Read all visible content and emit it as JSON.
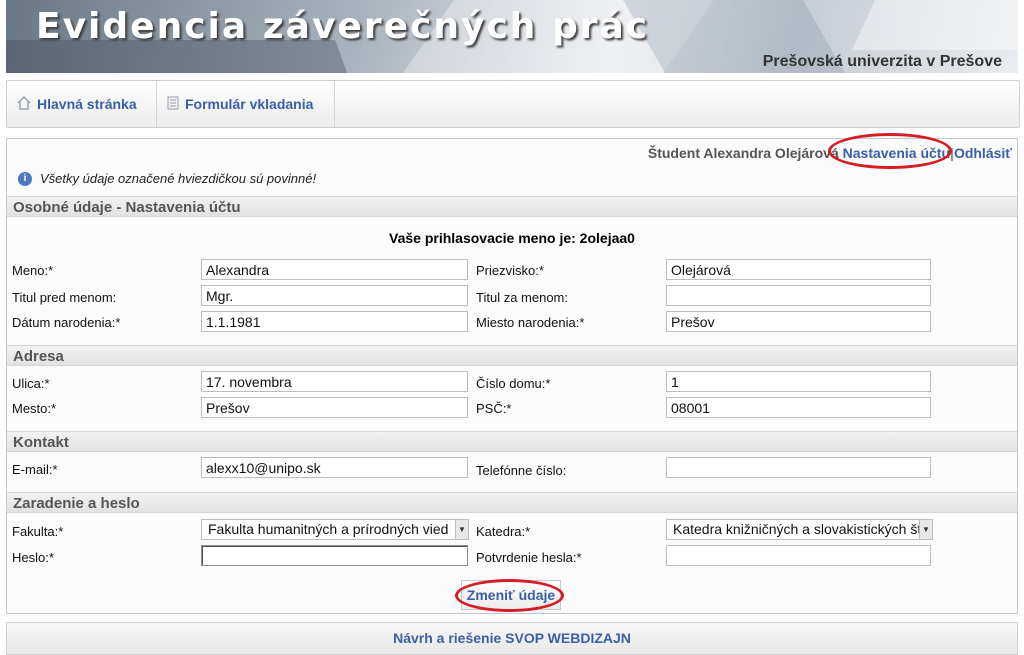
{
  "header": {
    "title": "Evidencia záverečných prác",
    "university": "Prešovská univerzita v Prešove"
  },
  "nav": {
    "items": [
      {
        "label": "Hlavná stránka",
        "icon": "home-icon"
      },
      {
        "label": "Formulár vkladania",
        "icon": "document-icon"
      }
    ]
  },
  "user": {
    "name": "Študent Alexandra Olejárová",
    "settings_link": "Nastavenia účtu",
    "separator": "|",
    "logout_link": "Odhlásiť"
  },
  "info_message": "Všetky údaje označené hviezdičkou sú povinné!",
  "sections": {
    "personal": "Osobné údaje - Nastavenia účtu",
    "address": "Adresa",
    "contact": "Kontakt",
    "assignment": "Zaradenie a heslo"
  },
  "login_line": "Vaše prihlasovacie meno je: 2olejaa0",
  "fields": {
    "meno": {
      "label": "Meno:*",
      "value": "Alexandra"
    },
    "priezvisko": {
      "label": "Priezvisko:*",
      "value": "Olejárová"
    },
    "titul_pred": {
      "label": "Titul pred menom:",
      "value": "Mgr."
    },
    "titul_za": {
      "label": "Titul za menom:",
      "value": ""
    },
    "datum": {
      "label": "Dátum narodenia:*",
      "value": "1.1.1981"
    },
    "miesto": {
      "label": "Miesto narodenia:*",
      "value": "Prešov"
    },
    "ulica": {
      "label": "Ulica:*",
      "value": "17. novembra"
    },
    "cislo": {
      "label": "Číslo domu:*",
      "value": "1"
    },
    "mesto": {
      "label": "Mesto:*",
      "value": "Prešov"
    },
    "psc": {
      "label": "PSČ:*",
      "value": "08001"
    },
    "email": {
      "label": "E-mail:*",
      "value": "alexx10@unipo.sk"
    },
    "telefon": {
      "label": "Telefónne číslo:",
      "value": ""
    },
    "fakulta": {
      "label": "Fakulta:*",
      "value": "Fakulta humanitných a prírodných vied"
    },
    "katedra": {
      "label": "Katedra:*",
      "value": "Katedra knižničných a slovakistických štúdií"
    },
    "heslo": {
      "label": "Heslo:*",
      "value": ""
    },
    "potvrdenie": {
      "label": "Potvrdenie hesla:*",
      "value": ""
    }
  },
  "submit_label": "Zmeniť údaje",
  "footer": "Návrh a riešenie SVOP WEBDIZAJN",
  "colors": {
    "link": "#3b5ea8",
    "highlight": "#d41d24"
  }
}
